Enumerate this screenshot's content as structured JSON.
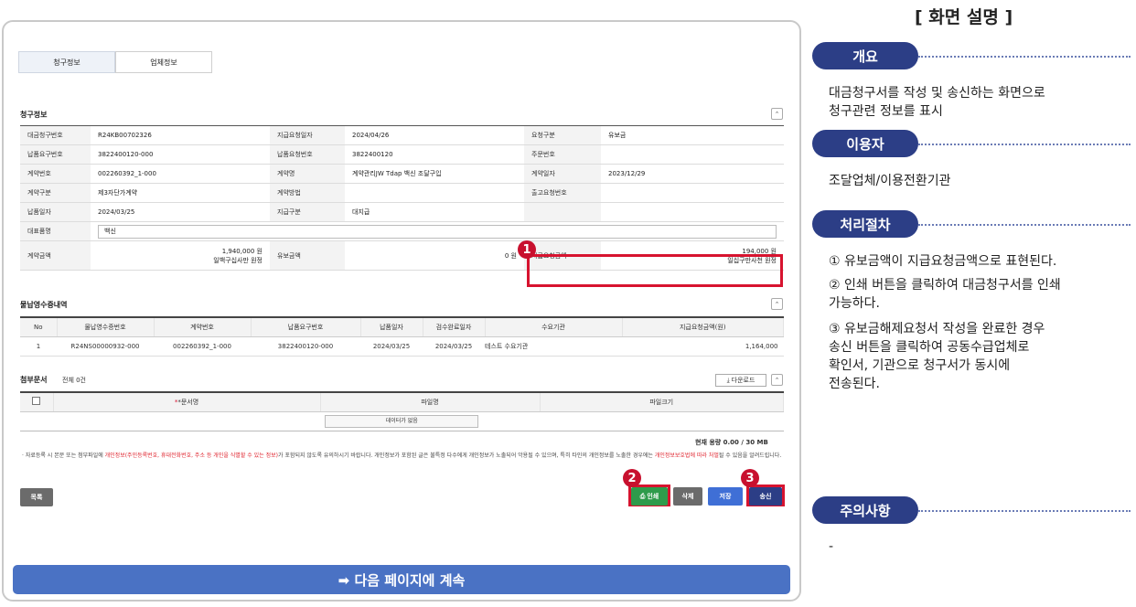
{
  "tabs": [
    "청구정보",
    "업체정보"
  ],
  "billing": {
    "title": "청구정보",
    "rows": [
      [
        "대금청구번호",
        "R24KB00702326",
        "지급요청일자",
        "2024/04/26",
        "요청구분",
        "유보금"
      ],
      [
        "납품요구번호",
        "3822400120-000",
        "납품요청번호",
        "3822400120",
        "주문번호",
        ""
      ],
      [
        "계약번호",
        "002260392_1-000",
        "계약명",
        "계약관리JW Tdap 백신 조달구입",
        "계약일자",
        "2023/12/29"
      ],
      [
        "계약구분",
        "제3자단가계약",
        "계약방법",
        "",
        "출고요청번호",
        ""
      ],
      [
        "납품일자",
        "2024/03/25",
        "지급구분",
        "대지급",
        "",
        ""
      ]
    ],
    "item_label": "대표품명",
    "item_value": "백신",
    "contract_amount_label": "계약금액",
    "contract_amount": "1,940,000 원",
    "contract_amount_sub": "일백구십사만 원정",
    "retention_label": "유보금액",
    "retention_amount": "0 원",
    "request_amount_label": "지급요청금액",
    "request_amount": "194,000 원",
    "request_amount_sub": "일십구만사천 원정"
  },
  "receipt": {
    "title": "물납영수증내역",
    "headers": [
      "No",
      "물납영수증번호",
      "계약번호",
      "납품요구번호",
      "납품일자",
      "검수완료일자",
      "수요기관",
      "지급요청금액(원)"
    ],
    "rows": [
      [
        "1",
        "R24NS00000932-000",
        "002260392_1-000",
        "3822400120-000",
        "2024/03/25",
        "2024/03/25",
        "테스트 수요기관",
        "1,164,000"
      ]
    ]
  },
  "attach": {
    "title": "첨부문서",
    "count": "전체 0건",
    "download": "다운로드",
    "headers": [
      "*문서명",
      "파일명",
      "파일크기"
    ],
    "empty": "데이터가 없음",
    "capacity": "현재 용량 0.00 / 30 MB"
  },
  "notice": {
    "a": "· 자료등록 시 본문 또는 첨부파일에 ",
    "b": "개인정보(주민등록번호, 휴대전화번호, 주소 등 개인을 식별할 수 있는 정보)",
    "c": "가 포함되지 않도록 유의하시기 바랍니다. 개인정보가 포함된 글은 불특정 다수에게 개인정보가 노출되어 악용될 수 있으며, 특히 타인의 개인정보를 노출한 경우에는 ",
    "d": "개인정보보호법에 따라 처벌",
    "e": "될 수 있음을 알려드립니다."
  },
  "buttons": {
    "list": "목록",
    "print": "인쇄",
    "delete": "삭제",
    "save": "저장",
    "send": "송신"
  },
  "badges": [
    "1",
    "2",
    "3"
  ],
  "continue": "➡ 다음 페이지에 계속",
  "panel": {
    "title": "[ 화면 설명 ]",
    "overview_title": "개요",
    "overview_text": "대금청구서를 작성 및 송신하는 화면으로\n청구관련 정보를 표시",
    "user_title": "이용자",
    "user_text": "조달업체/이용전환기관",
    "process_title": "처리절차",
    "process_steps": [
      "① 유보금액이 지급요청금액으로 표현된다.",
      "② 인쇄 버튼을 클릭하여 대금청구서를 인쇄\n    가능하다.",
      "③ 유보금해제요청서 작성을 완료한 경우\n    송신 버튼을 클릭하여 공동수급업체로\n    확인서, 기관으로 청구서가 동시에\n    전송된다."
    ],
    "caution_title": "주의사항",
    "caution_text": "-"
  },
  "colors": {
    "accent": "#2c3e86",
    "highlight": "#d7132f",
    "bar": "#4a72c4"
  }
}
